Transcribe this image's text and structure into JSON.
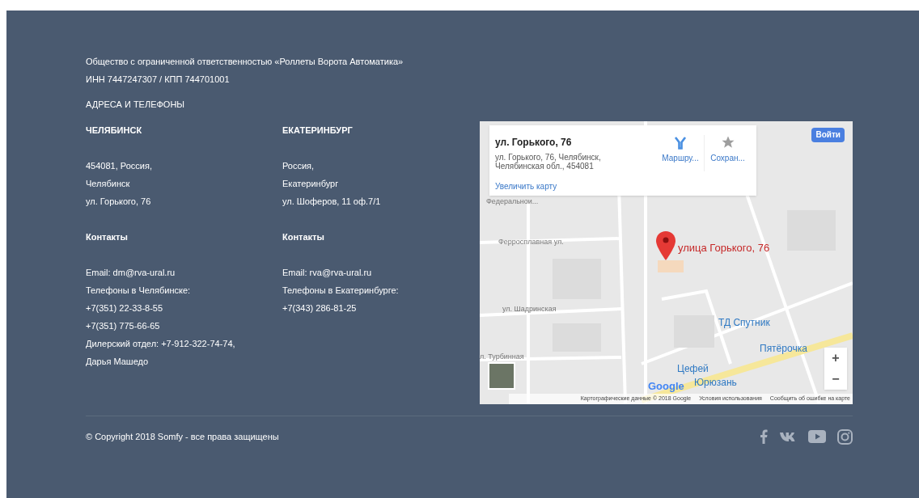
{
  "company": {
    "name": "Общество с ограниченной ответственностью «Роллеты Ворота Автоматика»",
    "ids": "ИНН 7447247307 / КПП 744701001"
  },
  "section_title": "АДРЕСА И ТЕЛЕФОНЫ",
  "offices": [
    {
      "city": "ЧЕЛЯБИНСК",
      "address": [
        "454081, Россия,",
        "Челябинск",
        "ул. Горького, 76"
      ],
      "contacts_title": "Контакты",
      "contacts": [
        "Email: dm@rva-ural.ru",
        "Телефоны в Челябинске:",
        "+7(351) 22-33-8-55",
        "+7(351) 775-66-65",
        "Дилерский отдел: +7-912-322-74-74,",
        "Дарья Машедо"
      ]
    },
    {
      "city": "ЕКАТЕРИНБУРГ",
      "address": [
        "Россия,",
        "Екатеринбург",
        "ул. Шоферов, 11 оф.7/1"
      ],
      "contacts_title": "Контакты",
      "contacts": [
        "Email: rva@rva-ural.ru",
        "Телефоны в Екатеринбурге:",
        "+7(343) 286-81-25"
      ]
    }
  ],
  "map": {
    "place_card": {
      "title": "ул. Горького, 76",
      "address": "ул. Горького, 76, Челябинск,\nЧелябинская обл., 454081",
      "link": "Увеличить карту",
      "actions": [
        "Маршру...",
        "Сохран..."
      ]
    },
    "sign_in": "Войти",
    "marker_label": "улица Горького, 76",
    "labels": [
      {
        "text": "Федеральнои...",
        "kind": "street"
      },
      {
        "text": "Ферросплавная ул.",
        "kind": "street"
      },
      {
        "text": "ул. Шадринская",
        "kind": "street"
      },
      {
        "text": "л. Турбинная",
        "kind": "street"
      },
      {
        "text": "ТД Спутник",
        "kind": "poi"
      },
      {
        "text": "Пятёрочка",
        "kind": "poi"
      },
      {
        "text": "Цефей",
        "kind": "poi"
      },
      {
        "text": "Юрюзань",
        "kind": "poi"
      }
    ],
    "zoom_controls": [
      "+",
      "−"
    ],
    "logo": "Google",
    "footer_links": [
      "Картографические данные © 2018 Google",
      "Условия использования",
      "Сообщить об ошибке на карте"
    ]
  },
  "copyright": "© Copyright 2018 Somfy - все права защищены"
}
